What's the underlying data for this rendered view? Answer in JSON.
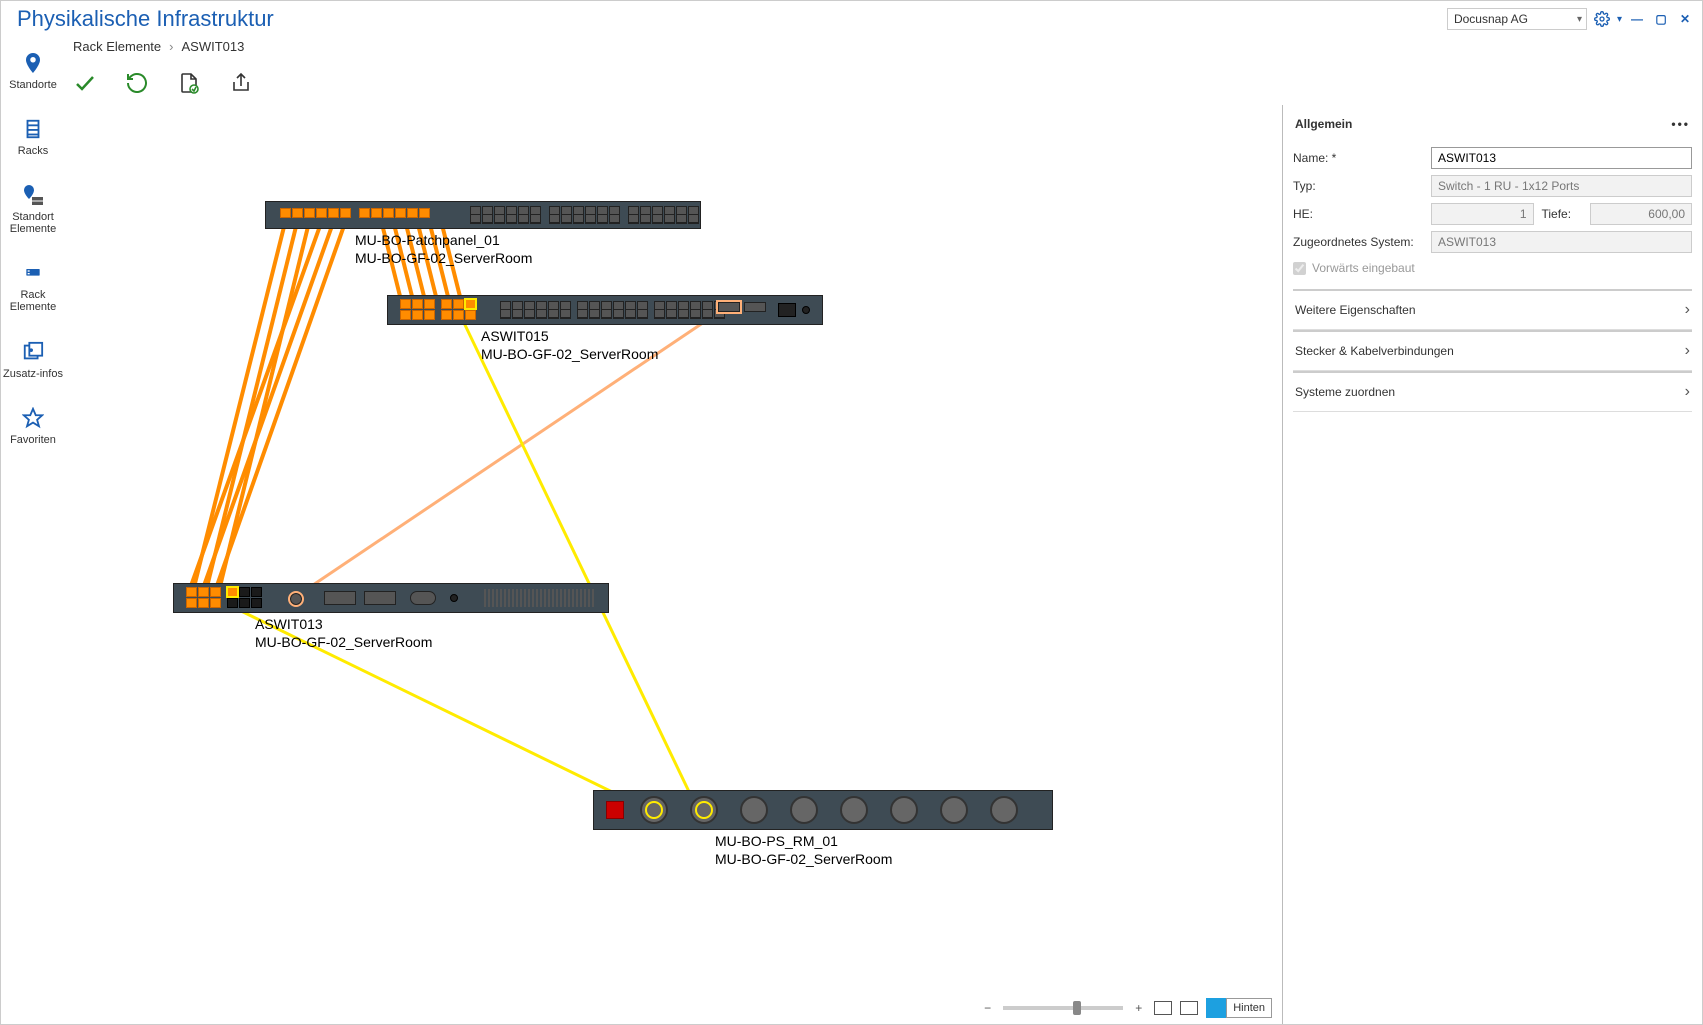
{
  "title": "Physikalische Infrastruktur",
  "tenant": "Docusnap AG",
  "breadcrumb": {
    "parent": "Rack Elemente",
    "current": "ASWIT013"
  },
  "sidebar": {
    "items": [
      {
        "label": "Standorte"
      },
      {
        "label": "Racks"
      },
      {
        "label": "Standort Elemente"
      },
      {
        "label": "Rack Elemente"
      },
      {
        "label": "Zusatz-infos"
      },
      {
        "label": "Favoriten"
      }
    ]
  },
  "devices": {
    "patchpanel": {
      "name": "MU-BO-Patchpanel_01",
      "location": "MU-BO-GF-02_ServerRoom"
    },
    "switch15": {
      "name": "ASWIT015",
      "location": "MU-BO-GF-02_ServerRoom"
    },
    "switch13": {
      "name": "ASWIT013",
      "location": "MU-BO-GF-02_ServerRoom"
    },
    "pdu": {
      "name": "MU-BO-PS_RM_01",
      "location": "MU-BO-GF-02_ServerRoom"
    }
  },
  "panel": {
    "header": "Allgemein",
    "labels": {
      "name": "Name: *",
      "type": "Typ:",
      "he": "HE:",
      "depth": "Tiefe:",
      "assigned": "Zugeordnetes System:",
      "forward": "Vorwärts eingebaut"
    },
    "values": {
      "name": "ASWIT013",
      "type": "Switch - 1 RU - 1x12 Ports",
      "he": "1",
      "depth": "600,00",
      "assigned": "ASWIT013"
    },
    "sections": {
      "s1": "Weitere Eigenschaften",
      "s2": "Stecker & Kabelverbindungen",
      "s3": "Systeme zuordnen"
    }
  },
  "bottom": {
    "back_label": "Hinten"
  }
}
